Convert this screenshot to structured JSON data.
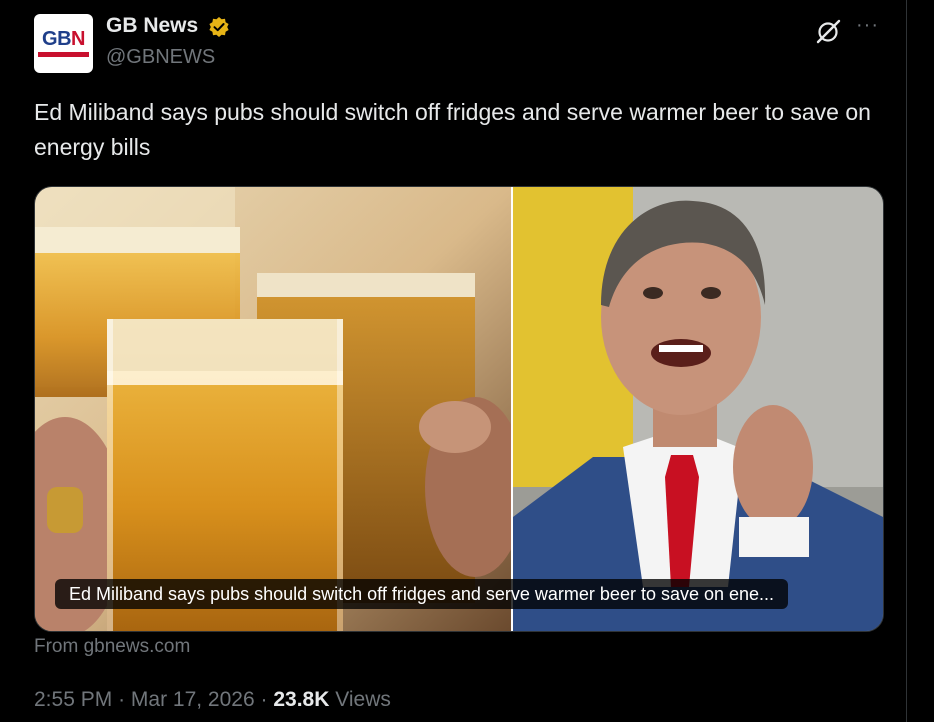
{
  "author": {
    "name": "GB News",
    "handle": "@GBNEWS",
    "avatar_text_left": "GB",
    "avatar_text_right": "N",
    "verified_color": "#e7b416"
  },
  "tweet": {
    "text": "Ed Miliband says pubs should switch off fridges and serve warmer beer to save on energy bills"
  },
  "card": {
    "title": "Ed Miliband says pubs should switch off fridges and serve warmer beer to save on ene...",
    "source": "From gbnews.com"
  },
  "meta": {
    "time": "2:55 PM",
    "sep1": "·",
    "date": "Mar 17, 2026",
    "sep2": "·",
    "views_count": "23.8K",
    "views_label": "Views"
  },
  "icons": {
    "grok": "grok-icon",
    "more": "more-icon",
    "more_glyph": "···"
  }
}
